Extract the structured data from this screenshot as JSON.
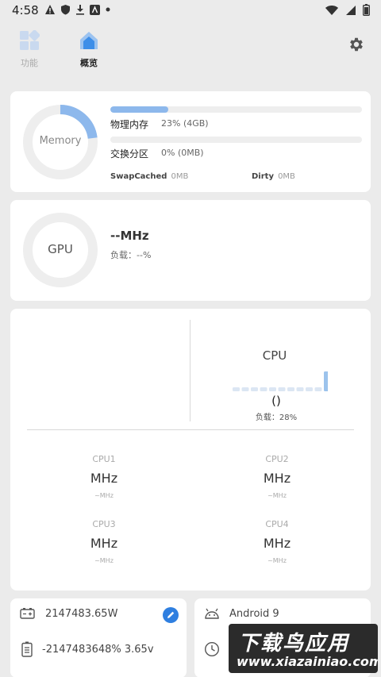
{
  "status_bar": {
    "time": "4:58",
    "icons": [
      "alert-icon",
      "shield-icon",
      "download-icon",
      "a-icon",
      "dot-icon"
    ],
    "right_icons": [
      "wifi-icon",
      "signal-icon",
      "battery-icon"
    ]
  },
  "nav": {
    "tabs": [
      {
        "label": "功能",
        "icon": "grid-icon",
        "active": false
      },
      {
        "label": "概览",
        "icon": "home-icon",
        "active": true
      }
    ],
    "settings_icon": "gear-icon"
  },
  "memory": {
    "ring_label": "Memory",
    "ring_fraction": 0.23,
    "physical_label": "物理内存",
    "physical_value": "23% (4GB)",
    "physical_fraction": 0.23,
    "swap_label": "交换分区",
    "swap_value": "0% (0MB)",
    "swap_fraction": 0.0,
    "swapcached_label": "SwapCached",
    "swapcached_value": "0MB",
    "dirty_label": "Dirty",
    "dirty_value": "0MB"
  },
  "gpu": {
    "ring_label": "GPU",
    "freq": "--MHz",
    "load": "负载：--%"
  },
  "cpu": {
    "title": "CPU",
    "value": "()",
    "load": "负载：28%",
    "history": [
      0.2,
      0.2,
      0.2,
      0.2,
      0.2,
      0.2,
      0.2,
      0.2,
      0.2,
      0.2,
      1.0
    ],
    "cores": [
      {
        "name": "CPU1",
        "freq": "MHz",
        "sub": "~MHz"
      },
      {
        "name": "CPU2",
        "freq": "MHz",
        "sub": "~MHz"
      },
      {
        "name": "CPU3",
        "freq": "MHz",
        "sub": "~MHz"
      },
      {
        "name": "CPU4",
        "freq": "MHz",
        "sub": "~MHz"
      }
    ]
  },
  "battery": {
    "capacity": "2147483.65W",
    "status": "-2147483648%  3.65v",
    "edit_icon": "pencil-icon"
  },
  "device": {
    "os": "Android 9",
    "uptime_icon": "clock-icon"
  },
  "watermark": {
    "title": "下载鸟应用",
    "url": "www.xiazainiao.com"
  },
  "colors": {
    "accent": "#8db8ec",
    "active_tab": "#3d8ee8",
    "edit_button": "#2f7fe0"
  }
}
